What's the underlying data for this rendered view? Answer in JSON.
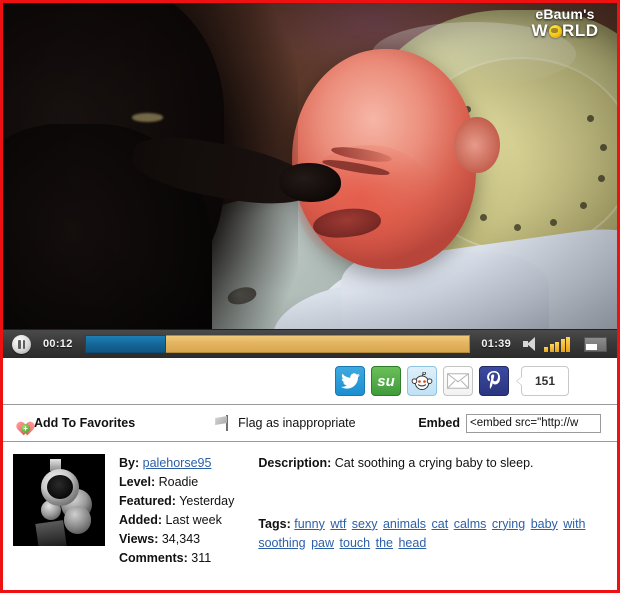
{
  "player": {
    "watermark": {
      "line1": "eBaum's",
      "word_before_globe": "W",
      "word_after_globe": "RLD",
      "globe_icon": "globe-icon"
    },
    "controls": {
      "pause_icon": "pause-icon",
      "current_time": "00:12",
      "total_time": "01:39",
      "buffered_percent": 21,
      "speaker_icon": "speaker-icon",
      "volume_bars": 5,
      "fullscreen_icon": "fullscreen-icon"
    },
    "scene": {
      "description": "Dark cat reaching a paw toward a crying baby lying on cushions"
    }
  },
  "share": {
    "buttons": [
      {
        "name": "twitter-share-button",
        "label": "Twitter"
      },
      {
        "name": "stumbleupon-share-button",
        "label": "StumbleUpon"
      },
      {
        "name": "reddit-share-button",
        "label": "Reddit"
      },
      {
        "name": "email-share-button",
        "label": "Email"
      },
      {
        "name": "pinterest-share-button",
        "label": "Pinterest"
      }
    ],
    "count": "151"
  },
  "actions": {
    "favorites_label": "Add To Favorites",
    "favorites_icon": "heart-plus-icon",
    "flag_label": "Flag as inappropriate",
    "flag_icon": "flag-icon",
    "embed_label": "Embed",
    "embed_value": "<embed src=\"http://w",
    "embed_placeholder": ""
  },
  "info": {
    "avatar_icon": "revolver-avatar",
    "meta": {
      "by_label": "By:",
      "by_value": "palehorse95",
      "level_label": "Level:",
      "level_value": "Roadie",
      "featured_label": "Featured:",
      "featured_value": "Yesterday",
      "added_label": "Added:",
      "added_value": "Last week",
      "views_label": "Views:",
      "views_value": "34,343",
      "comments_label": "Comments:",
      "comments_value": "311"
    },
    "description_label": "Description:",
    "description_value": "Cat soothing a crying baby to sleep.",
    "tags_label": "Tags:",
    "tags": [
      "funny",
      "wtf",
      "sexy",
      "animals",
      "cat",
      "calms",
      "crying",
      "baby",
      "with",
      "soothing",
      "paw",
      "touch",
      "the",
      "head"
    ]
  },
  "colors": {
    "page_border": "#ee1111",
    "divider": "#9a9a9a",
    "link": "#2b5fa8",
    "progress_buffered": "#14679a",
    "progress_remaining": "#e3b462",
    "volume": "#e8a317"
  }
}
